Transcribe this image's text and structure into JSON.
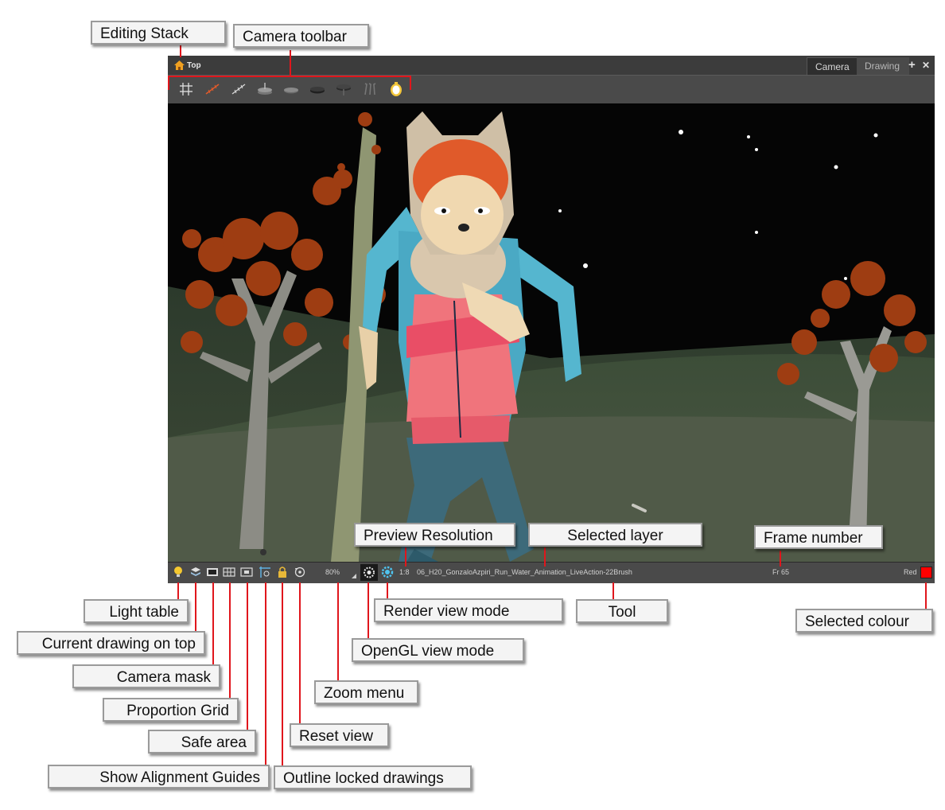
{
  "window": {
    "editing_stack": "Top",
    "tabs": [
      {
        "label": "Camera",
        "active": true
      },
      {
        "label": "Drawing",
        "active": false
      }
    ],
    "add_view_button": "+",
    "close_view_button": "✕"
  },
  "camera_toolbar": {
    "tools": [
      "grid-icon",
      "onion-skin-icon",
      "onion-skin-outline-icon",
      "layer-stack-icon",
      "disc-icon",
      "disc-dark-icon",
      "disc-dark-2-icon",
      "sticks-icon",
      "palette-lock-icon"
    ]
  },
  "status_bar": {
    "zoom": "80%",
    "preview_resolution": "1:8",
    "selected_layer": "06_H20_GonzaloAzpiri_Run_Water_Animation_LiveAction-22Brush",
    "frame_number": "Fr 65",
    "selected_colour_name": "Red",
    "selected_colour_hex": "#ff0000"
  },
  "callouts": {
    "editing_stack": "Editing Stack",
    "camera_toolbar": "Camera toolbar",
    "preview_resolution": "Preview Resolution",
    "selected_layer": "Selected layer",
    "frame_number": "Frame number",
    "light_table": "Light table",
    "current_drawing_on_top": "Current drawing on top",
    "camera_mask": "Camera mask",
    "proportion_grid": "Proportion Grid",
    "safe_area": "Safe area",
    "show_alignment_guides": "Show Alignment Guides",
    "outline_locked_drawings": "Outline locked drawings",
    "reset_view": "Reset view",
    "zoom_menu": "Zoom menu",
    "opengl_view_mode": "OpenGL view mode",
    "render_view_mode": "Render view mode",
    "tool": "Tool",
    "selected_colour": "Selected colour"
  }
}
